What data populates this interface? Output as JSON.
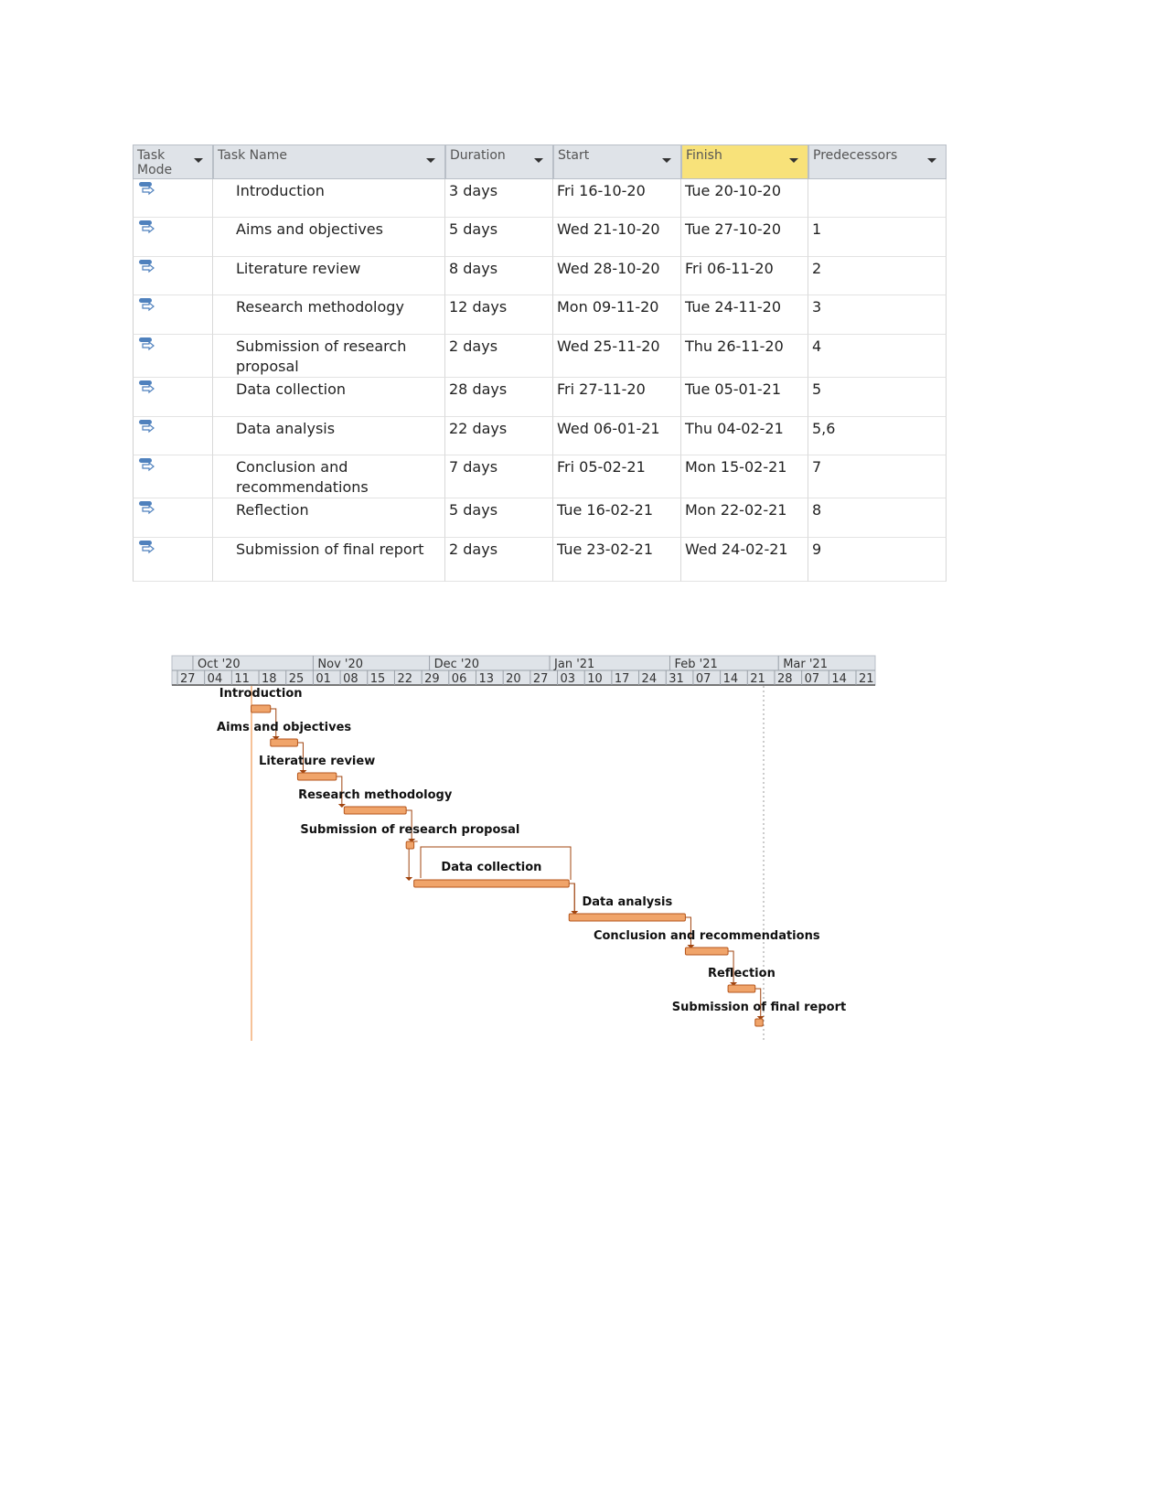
{
  "table": {
    "headers": [
      "Task Mode",
      "Task Name",
      "Duration",
      "Start",
      "Finish",
      "Predecessors"
    ],
    "highlighted_header": "Finish",
    "task_mode_icon": "auto-scheduled-task-icon",
    "rows": [
      {
        "name": "Introduction",
        "duration": "3 days",
        "start": "Fri 16-10-20",
        "finish": "Tue 20-10-20",
        "pred": ""
      },
      {
        "name": "Aims and objectives",
        "duration": "5 days",
        "start": "Wed 21-10-20",
        "finish": "Tue 27-10-20",
        "pred": "1"
      },
      {
        "name": "Literature review",
        "duration": "8 days",
        "start": "Wed 28-10-20",
        "finish": "Fri 06-11-20",
        "pred": "2"
      },
      {
        "name": "Research methodology",
        "duration": "12 days",
        "start": "Mon 09-11-20",
        "finish": "Tue 24-11-20",
        "pred": "3"
      },
      {
        "name": "Submission of research proposal",
        "duration": "2 days",
        "start": "Wed 25-11-20",
        "finish": "Thu 26-11-20",
        "pred": "4"
      },
      {
        "name": "Data collection",
        "duration": "28 days",
        "start": "Fri 27-11-20",
        "finish": "Tue 05-01-21",
        "pred": "5"
      },
      {
        "name": "Data analysis",
        "duration": "22 days",
        "start": "Wed 06-01-21",
        "finish": "Thu 04-02-21",
        "pred": "5,6"
      },
      {
        "name": "Conclusion and recommendations",
        "duration": "7 days",
        "start": "Fri 05-02-21",
        "finish": "Mon 15-02-21",
        "pred": "7"
      },
      {
        "name": "Reflection",
        "duration": "5 days",
        "start": "Tue 16-02-21",
        "finish": "Mon 22-02-21",
        "pred": "8"
      },
      {
        "name": "Submission of final report",
        "duration": "2 days",
        "start": "Tue 23-02-21",
        "finish": "Wed 24-02-21",
        "pred": "9"
      }
    ]
  },
  "gantt": {
    "months": [
      "Oct '20",
      "Nov '20",
      "Dec '20",
      "Jan '21",
      "Feb '21",
      "Mar '21"
    ],
    "weeks": [
      "27",
      "04",
      "11",
      "18",
      "25",
      "01",
      "08",
      "15",
      "22",
      "29",
      "06",
      "13",
      "20",
      "27",
      "03",
      "10",
      "17",
      "24",
      "31",
      "07",
      "14",
      "21",
      "28",
      "07",
      "14",
      "21"
    ],
    "colors": {
      "bar": "#f0a46a",
      "bar_border": "#b5561c",
      "link": "#a0440f",
      "start_line": "#f0a060",
      "status_line": "#999999",
      "timescale_bg": "#dfe3e8"
    }
  }
}
